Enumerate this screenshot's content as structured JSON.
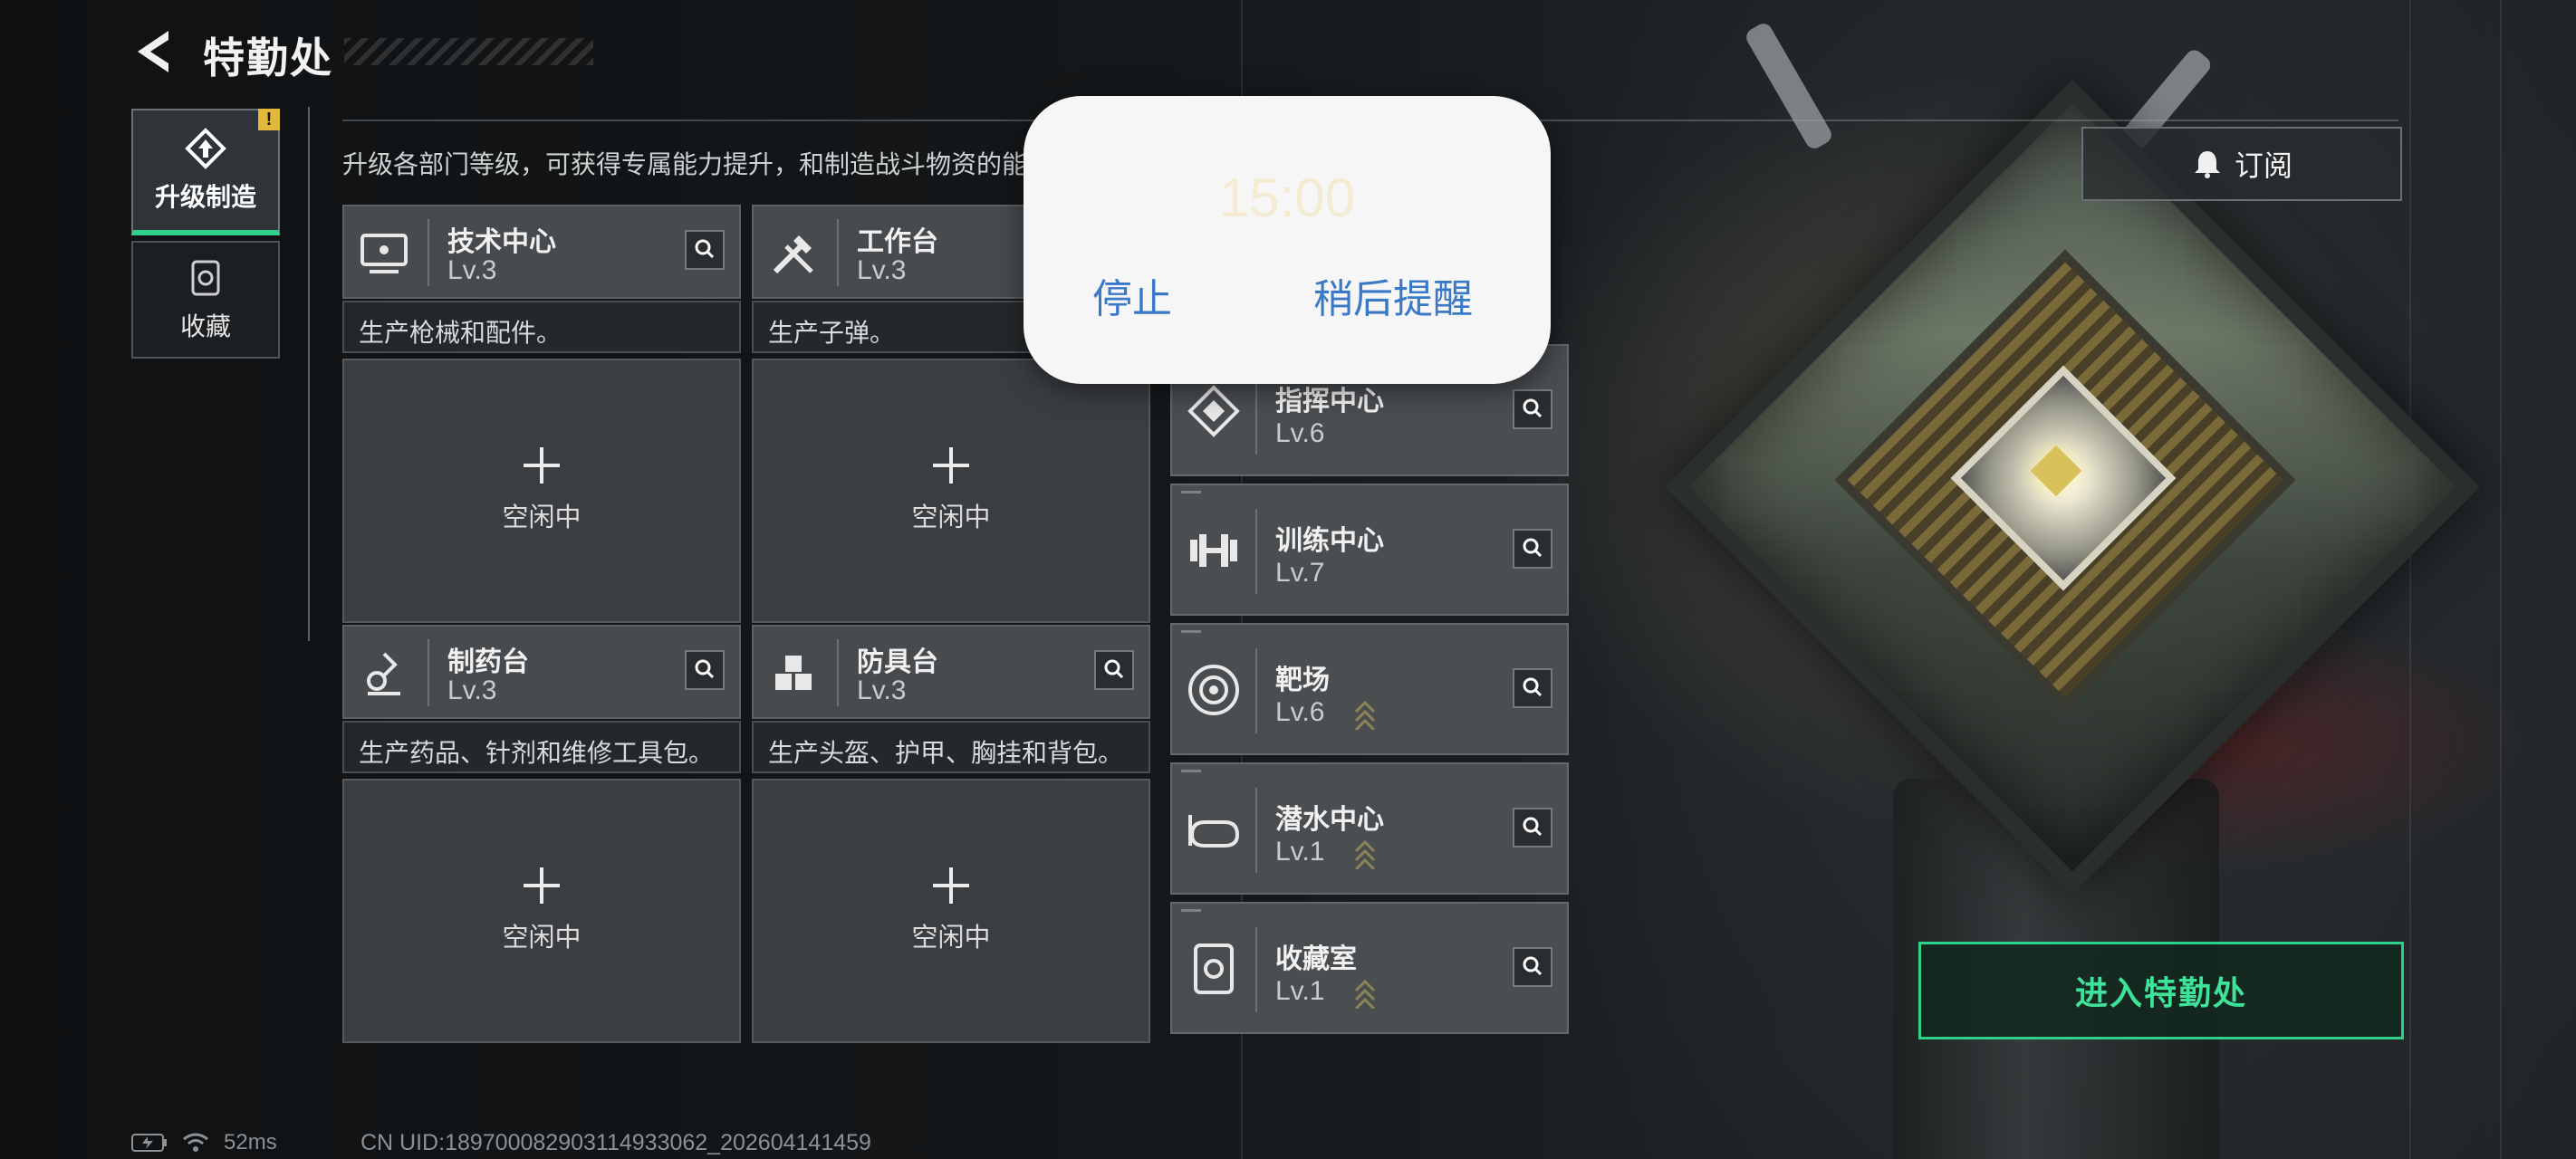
{
  "header": {
    "title": "特勤处",
    "back_icon": "chevron-left-icon"
  },
  "tabs": [
    {
      "label": "升级制造",
      "icon": "upgrade-icon",
      "active": true,
      "badge": "!"
    },
    {
      "label": "收藏",
      "icon": "collection-icon",
      "active": false
    }
  ],
  "description": "升级各部门等级，可获得专属能力提升，和制造战斗物资的能",
  "production": [
    {
      "name": "技术中心",
      "level": "Lv.3",
      "icon": "tech-center-icon",
      "desc": "生产枪械和配件。",
      "slot": "空闲中"
    },
    {
      "name": "工作台",
      "level": "Lv.3",
      "icon": "workbench-icon",
      "desc": "生产子弹。",
      "slot": "空闲中"
    },
    {
      "name": "制药台",
      "level": "Lv.3",
      "icon": "pharmacy-icon",
      "desc": "生产药品、针剂和维修工具包。",
      "slot": "空闲中"
    },
    {
      "name": "防具台",
      "level": "Lv.3",
      "icon": "armory-icon",
      "desc": "生产头盔、护甲、胸挂和背包。",
      "slot": "空闲中"
    }
  ],
  "facilities": [
    {
      "name": "指挥中心",
      "level": "Lv.6",
      "icon": "command-center-icon",
      "upgradable": false
    },
    {
      "name": "训练中心",
      "level": "Lv.7",
      "icon": "training-center-icon",
      "upgradable": false
    },
    {
      "name": "靶场",
      "level": "Lv.6",
      "icon": "shooting-range-icon",
      "upgradable": true
    },
    {
      "name": "潜水中心",
      "level": "Lv.1",
      "icon": "diving-center-icon",
      "upgradable": true
    },
    {
      "name": "收藏室",
      "level": "Lv.1",
      "icon": "collection-room-icon",
      "upgradable": true
    }
  ],
  "subscribe": {
    "label": "订阅",
    "icon": "bell-icon"
  },
  "enter_button": {
    "label": "进入特勤处"
  },
  "status": {
    "ping": "52ms",
    "uid": "CN UID:18970008290311493306​2_202604141459"
  },
  "popup": {
    "time": "15:00",
    "stop": "停止",
    "remind_later": "稍后提醒"
  },
  "colors": {
    "accent": "#2fd08a",
    "warning": "#e3b83a",
    "popup_button": "#3a78c8"
  }
}
